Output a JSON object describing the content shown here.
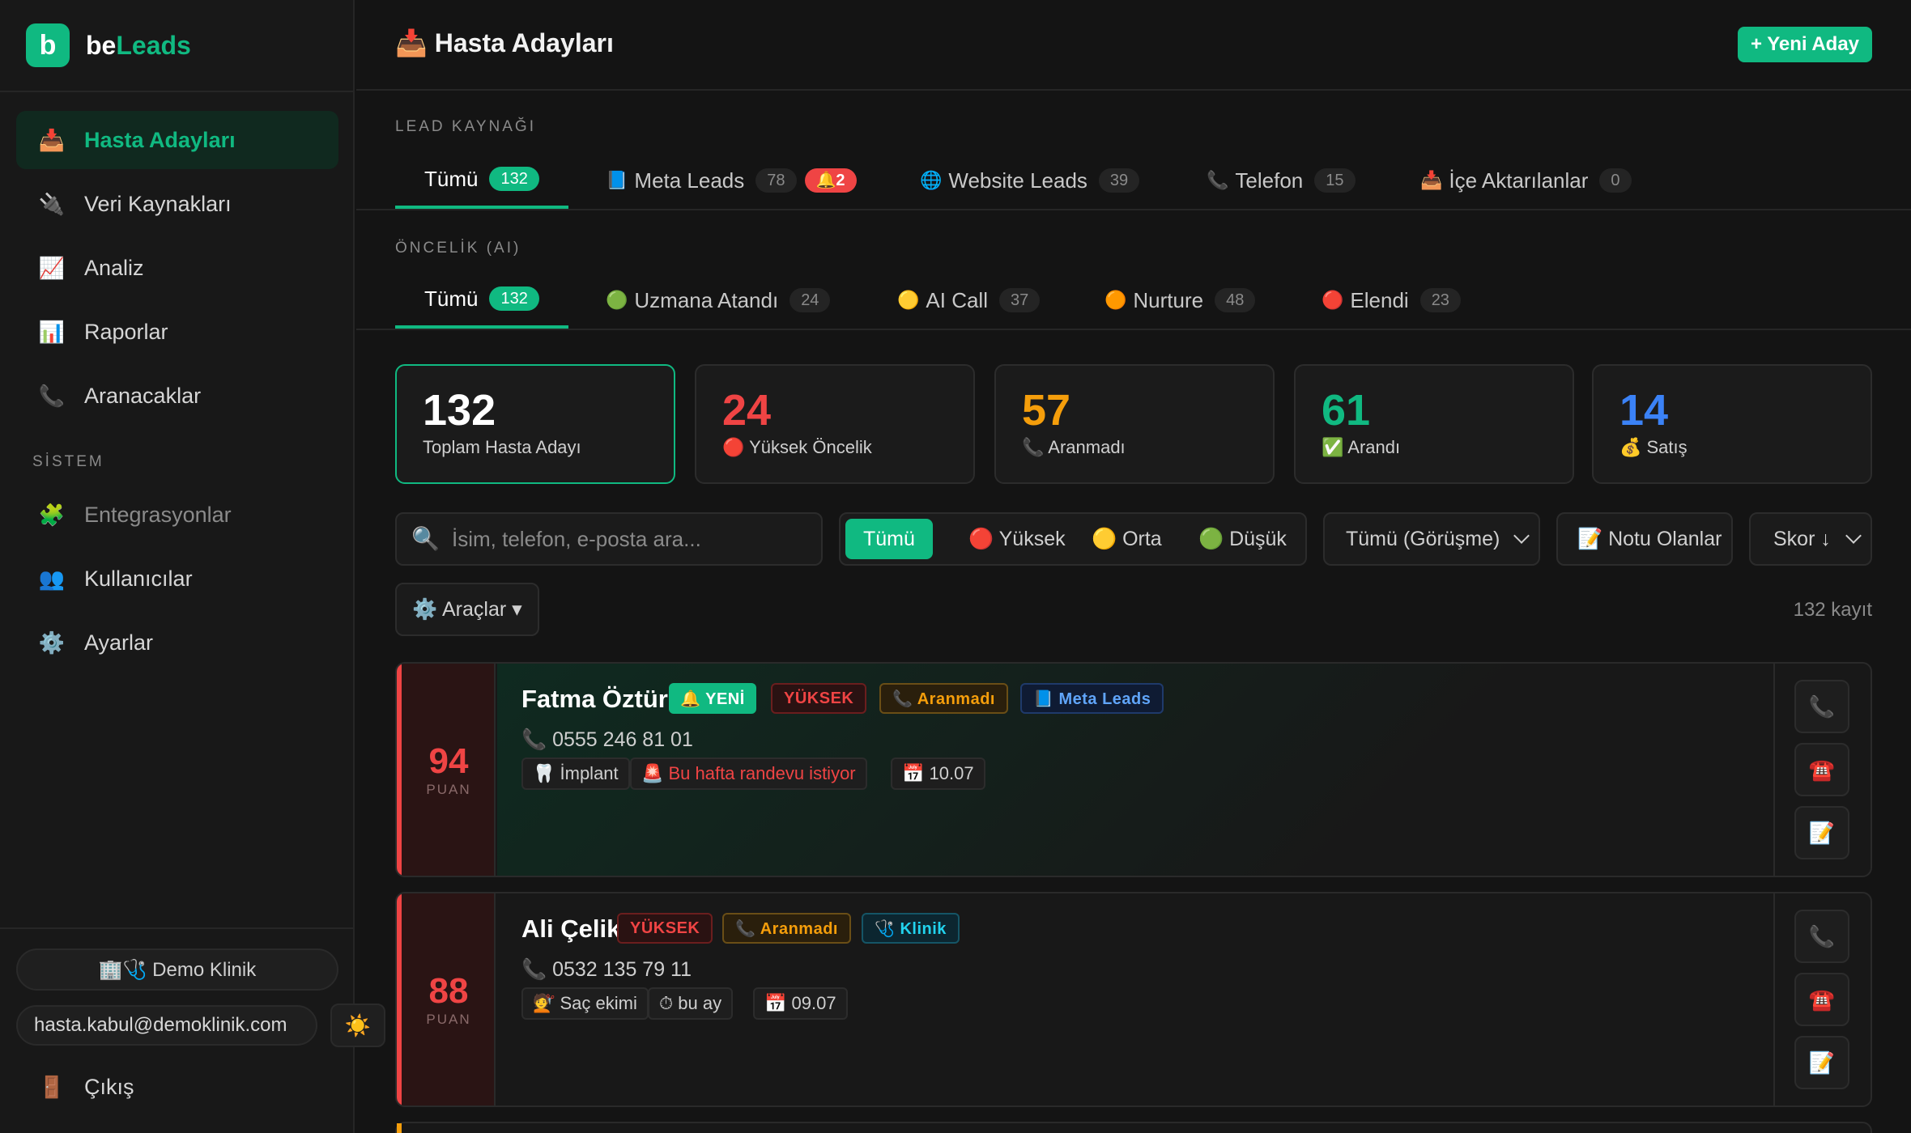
{
  "brand": {
    "logo_letter": "b",
    "name_part1": "be",
    "name_part2": "Leads"
  },
  "sidebar": {
    "items": [
      {
        "icon": "📥",
        "label": "Hasta Adayları",
        "active": true
      },
      {
        "icon": "🔌",
        "label": "Veri Kaynakları"
      },
      {
        "icon": "📈",
        "label": "Analiz"
      },
      {
        "icon": "📊",
        "label": "Raporlar"
      },
      {
        "icon": "📞",
        "label": "Aranacaklar"
      }
    ],
    "system_label": "SİSTEM",
    "system_items": [
      {
        "icon": "🧩",
        "label": "Entegrasyonlar",
        "dim": true
      },
      {
        "icon": "👥",
        "label": "Kullanıcılar"
      },
      {
        "icon": "⚙️",
        "label": "Ayarlar"
      }
    ],
    "clinic": "🏢🩺 Demo Klinik",
    "email": "hasta.kabul@demoklinik.com",
    "theme_icon": "☀️",
    "logout_icon": "🚪",
    "logout_label": "Çıkış"
  },
  "header": {
    "title": "📥 Hasta Adayları",
    "new_button": "+ Yeni Aday"
  },
  "lead_source": {
    "label": "LEAD KAYNAĞI",
    "tabs": [
      {
        "icon": "",
        "label": "Tümü",
        "count": "132",
        "active": true
      },
      {
        "icon": "📘",
        "label": "Meta Leads",
        "count": "78",
        "alert": "🔔2"
      },
      {
        "icon": "🌐",
        "label": "Website Leads",
        "count": "39"
      },
      {
        "icon": "📞",
        "label": "Telefon",
        "count": "15"
      },
      {
        "icon": "📥",
        "label": "İçe Aktarılanlar",
        "count": "0"
      }
    ]
  },
  "priority": {
    "label": "ÖNCELİK (AI)",
    "tabs": [
      {
        "icon": "",
        "label": "Tümü",
        "count": "132",
        "active": true
      },
      {
        "icon": "🟢",
        "label": "Uzmana Atandı",
        "count": "24"
      },
      {
        "icon": "🟡",
        "label": "AI Call",
        "count": "37"
      },
      {
        "icon": "🟠",
        "label": "Nurture",
        "count": "48"
      },
      {
        "icon": "🔴",
        "label": "Elendi",
        "count": "23"
      }
    ]
  },
  "stats": [
    {
      "value": "132",
      "label": "Toplam Hasta Adayı",
      "color": "#ffffff"
    },
    {
      "value": "24",
      "label": "🔴 Yüksek Öncelik",
      "color": "#ef4444"
    },
    {
      "value": "57",
      "label": "📞 Aranmadı",
      "color": "#f59e0b"
    },
    {
      "value": "61",
      "label": "✅ Arandı",
      "color": "#10b981"
    },
    {
      "value": "14",
      "label": "💰 Satış",
      "color": "#3b82f6"
    }
  ],
  "filters": {
    "search_placeholder": "İsim, telefon, e-posta ara...",
    "priority_options": [
      "Tümü",
      "🔴 Yüksek",
      "🟡 Orta",
      "🟢 Düşük"
    ],
    "interview_select": "Tümü (Görüşme)",
    "notes_button": "📝 Notu Olanlar",
    "sort_select": "Skor ↓",
    "tools_button": "⚙️ Araçlar ▾",
    "record_count": "132 kayıt"
  },
  "leads": [
    {
      "score": "94",
      "score_label": "PUAN",
      "name": "Fatma Öztürk",
      "badges": [
        "🔔 YENİ",
        "YÜKSEK",
        "📞 Aranmadı",
        "📘 Meta Leads"
      ],
      "phone": "📞 0555 246 81 01",
      "chips": [
        "🦷 İmplant",
        "🚨 Bu hafta randevu istiyor",
        "📅 10.07"
      ]
    },
    {
      "score": "88",
      "score_label": "PUAN",
      "name": "Ali Çelik",
      "badges": [
        "YÜKSEK",
        "📞 Aranmadı",
        "🩺 Klinik"
      ],
      "phone": "📞 0532 135 79 11",
      "chips": [
        "💇 Saç ekimi",
        "⏱ bu ay",
        "📅 09.07"
      ]
    }
  ],
  "card_actions": [
    "📞",
    "☎️",
    "📝"
  ],
  "colors": {
    "accent": "#10b981",
    "danger": "#ef4444",
    "warning": "#f59e0b",
    "info": "#3b82f6"
  }
}
